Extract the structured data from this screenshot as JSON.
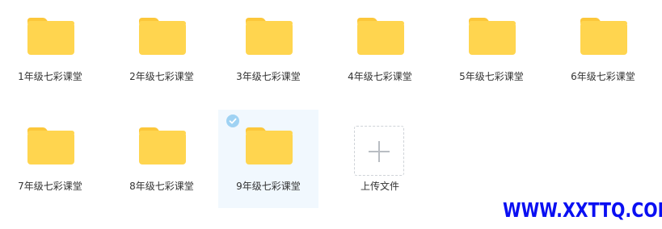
{
  "folders": [
    {
      "name": "1年级七彩课堂",
      "selected": false
    },
    {
      "name": "2年级七彩课堂",
      "selected": false
    },
    {
      "name": "3年级七彩课堂",
      "selected": false
    },
    {
      "name": "4年级七彩课堂",
      "selected": false
    },
    {
      "name": "5年级七彩课堂",
      "selected": false
    },
    {
      "name": "6年级七彩课堂",
      "selected": false
    },
    {
      "name": "7年级七彩课堂",
      "selected": false
    },
    {
      "name": "8年级七彩课堂",
      "selected": false
    },
    {
      "name": "9年级七彩课堂",
      "selected": true
    }
  ],
  "upload": {
    "label": "上传文件",
    "icon": "plus-icon"
  },
  "watermark": "WWW.XXTTQ.COM",
  "colors": {
    "folder": "#ffd54f",
    "folder_tab": "#fcc73a",
    "selected_bg": "#f1f8fe",
    "check": "#9fd2f3",
    "watermark": "#0a0ff2"
  }
}
